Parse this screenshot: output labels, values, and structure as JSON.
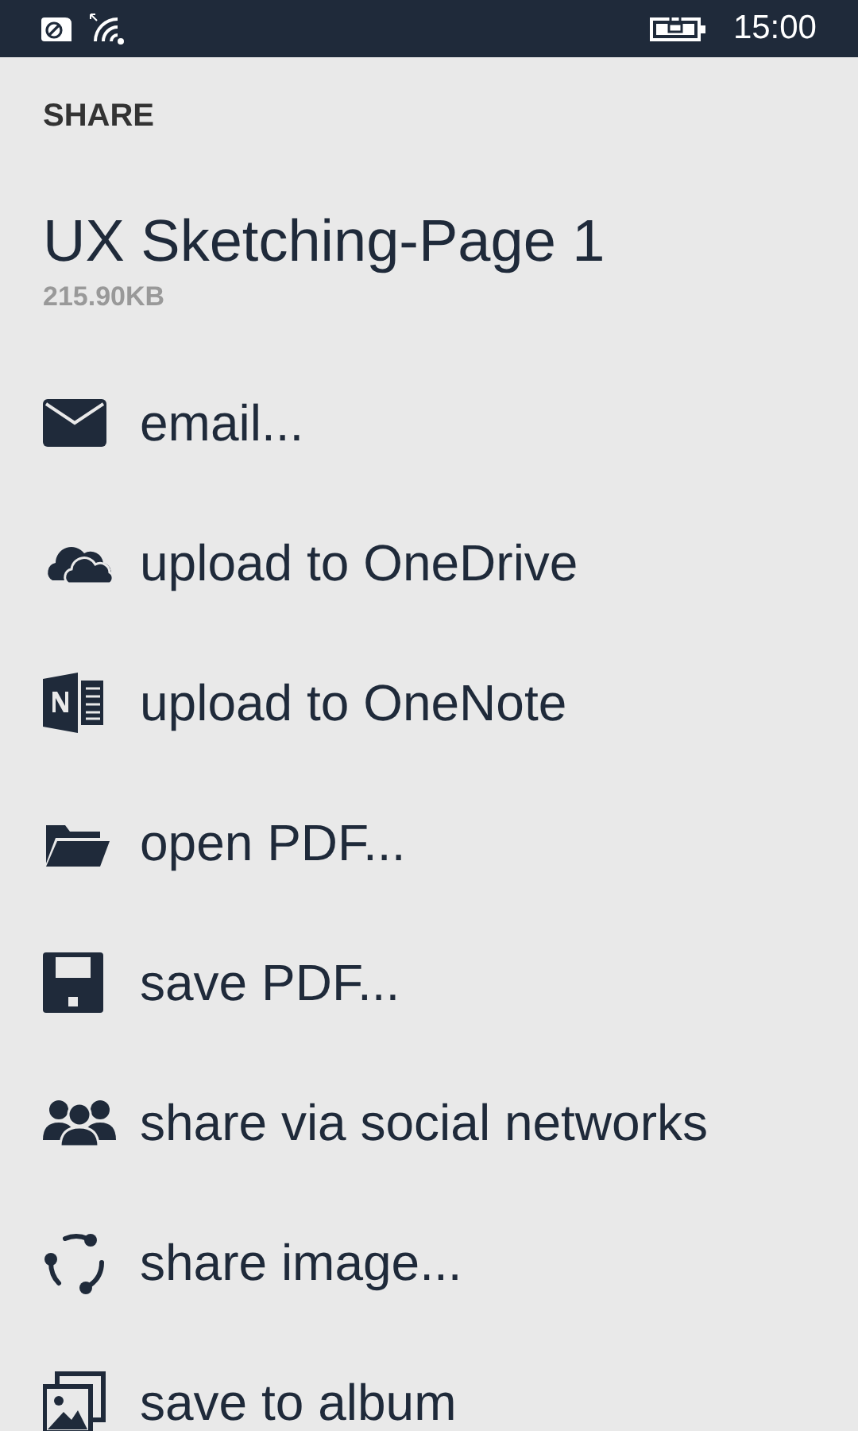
{
  "status_bar": {
    "time": "15:00"
  },
  "header": {
    "title": "SHARE"
  },
  "document": {
    "name": "UX Sketching-Page 1",
    "size": "215.90KB"
  },
  "actions": [
    {
      "kind": "email",
      "label": "email..."
    },
    {
      "kind": "cloud",
      "label": "upload to OneDrive"
    },
    {
      "kind": "notebook",
      "label": "upload to OneNote"
    },
    {
      "kind": "folder",
      "label": "open PDF..."
    },
    {
      "kind": "floppy",
      "label": "save PDF..."
    },
    {
      "kind": "people",
      "label": "share via social networks"
    },
    {
      "kind": "share",
      "label": "share image..."
    },
    {
      "kind": "album",
      "label": "save to album"
    }
  ]
}
